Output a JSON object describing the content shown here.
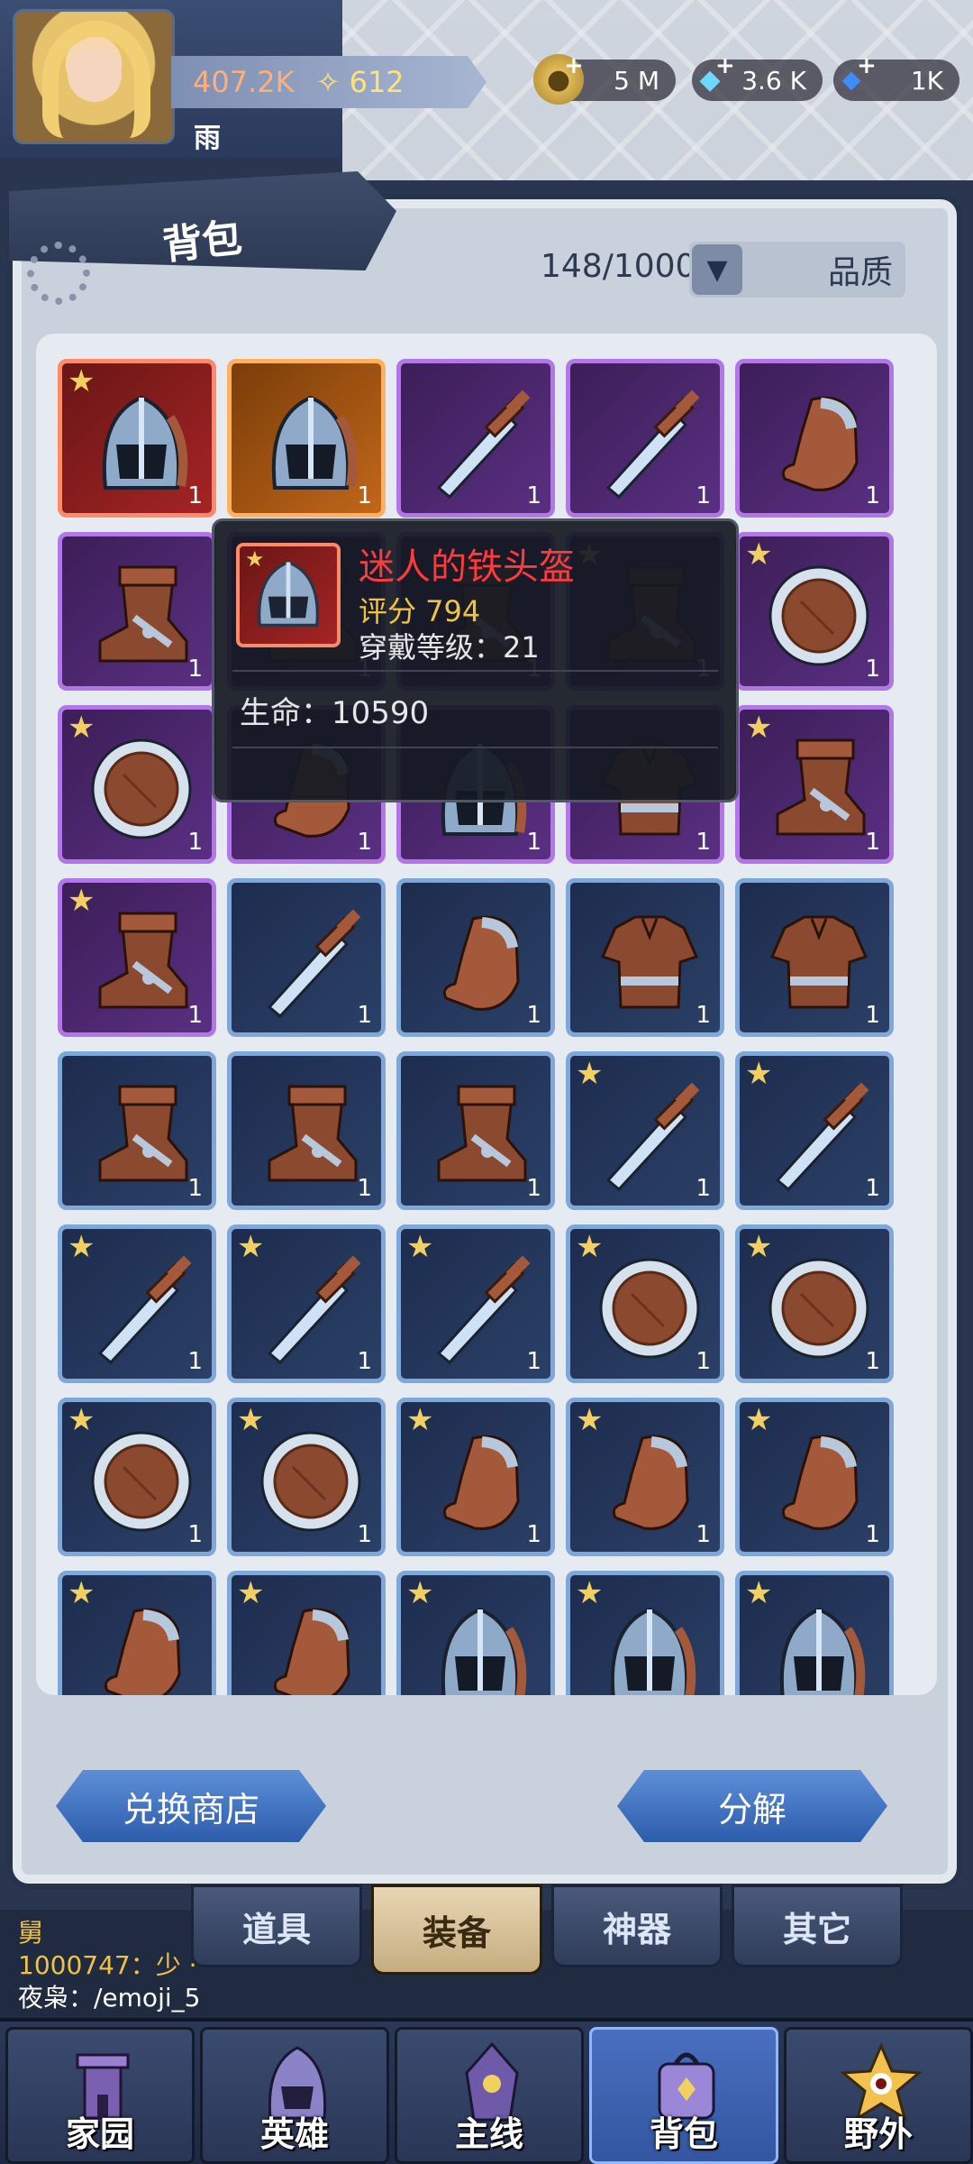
{
  "player": {
    "power": "407.2K",
    "level_label": "612",
    "name": "雨"
  },
  "currencies": {
    "gold": "5 M",
    "diamond": "3.6 K",
    "crystal": "1K"
  },
  "panel": {
    "title": "背包",
    "capacity": "148/1000",
    "filter_label": "品质"
  },
  "grid": {
    "rows": [
      [
        {
          "rarity": "red",
          "type": "helmet",
          "star": true,
          "qty": "1"
        },
        {
          "rarity": "orange",
          "type": "helmet",
          "star": false,
          "qty": "1"
        },
        {
          "rarity": "purple",
          "type": "sword",
          "star": false,
          "qty": "1"
        },
        {
          "rarity": "purple",
          "type": "sword",
          "star": false,
          "qty": "1"
        },
        {
          "rarity": "purple",
          "type": "glove",
          "star": false,
          "qty": "1"
        }
      ],
      [
        {
          "rarity": "purple",
          "type": "boot",
          "star": false,
          "qty": "1"
        },
        {
          "rarity": "purple",
          "type": "boot",
          "star": false,
          "qty": "1"
        },
        {
          "rarity": "purple",
          "type": "boot",
          "star": false,
          "qty": "1"
        },
        {
          "rarity": "purple",
          "type": "boot",
          "star": true,
          "qty": "1"
        },
        {
          "rarity": "purple",
          "type": "shield",
          "star": true,
          "qty": "1"
        }
      ],
      [
        {
          "rarity": "purple",
          "type": "shield",
          "star": true,
          "qty": "1"
        },
        {
          "rarity": "purple",
          "type": "glove",
          "star": false,
          "qty": "1"
        },
        {
          "rarity": "purple",
          "type": "helmet",
          "star": false,
          "qty": "1"
        },
        {
          "rarity": "purple",
          "type": "armor",
          "star": false,
          "qty": "1"
        },
        {
          "rarity": "purple",
          "type": "boot",
          "star": true,
          "qty": "1"
        }
      ],
      [
        {
          "rarity": "purple",
          "type": "boot",
          "star": true,
          "qty": "1"
        },
        {
          "rarity": "blue",
          "type": "sword",
          "star": false,
          "qty": "1"
        },
        {
          "rarity": "blue",
          "type": "glove",
          "star": false,
          "qty": "1"
        },
        {
          "rarity": "blue",
          "type": "armor",
          "star": false,
          "qty": "1"
        },
        {
          "rarity": "blue",
          "type": "armor",
          "star": false,
          "qty": "1"
        }
      ],
      [
        {
          "rarity": "blue",
          "type": "boot",
          "star": false,
          "qty": "1"
        },
        {
          "rarity": "blue",
          "type": "boot",
          "star": false,
          "qty": "1"
        },
        {
          "rarity": "blue",
          "type": "boot",
          "star": false,
          "qty": "1"
        },
        {
          "rarity": "blue",
          "type": "sword",
          "star": true,
          "qty": "1"
        },
        {
          "rarity": "blue",
          "type": "sword",
          "star": true,
          "qty": "1"
        }
      ],
      [
        {
          "rarity": "blue",
          "type": "sword",
          "star": true,
          "qty": "1"
        },
        {
          "rarity": "blue",
          "type": "sword",
          "star": true,
          "qty": "1"
        },
        {
          "rarity": "blue",
          "type": "sword",
          "star": true,
          "qty": "1"
        },
        {
          "rarity": "blue",
          "type": "shield",
          "star": true,
          "qty": "1"
        },
        {
          "rarity": "blue",
          "type": "shield",
          "star": true,
          "qty": "1"
        }
      ],
      [
        {
          "rarity": "blue",
          "type": "shield",
          "star": true,
          "qty": "1"
        },
        {
          "rarity": "blue",
          "type": "shield",
          "star": true,
          "qty": "1"
        },
        {
          "rarity": "blue",
          "type": "glove",
          "star": true,
          "qty": "1"
        },
        {
          "rarity": "blue",
          "type": "glove",
          "star": true,
          "qty": "1"
        },
        {
          "rarity": "blue",
          "type": "glove",
          "star": true,
          "qty": "1"
        }
      ],
      [
        {
          "rarity": "blue",
          "type": "glove",
          "star": true,
          "qty": ""
        },
        {
          "rarity": "blue",
          "type": "glove",
          "star": true,
          "qty": ""
        },
        {
          "rarity": "blue",
          "type": "helmet",
          "star": true,
          "qty": ""
        },
        {
          "rarity": "blue",
          "type": "helmet",
          "star": true,
          "qty": ""
        },
        {
          "rarity": "blue",
          "type": "helmet",
          "star": true,
          "qty": ""
        }
      ]
    ]
  },
  "tooltip": {
    "name": "迷人的铁头盔",
    "score": "评分 794",
    "wear_level": "穿戴等级：21",
    "life": "生命：10590",
    "name_color": "#ff3a3a"
  },
  "actions": {
    "exchange": "兑换商店",
    "decompose": "分解"
  },
  "chat": {
    "line1": "舅",
    "line2": "1000747：少  ·  ·  ·  ·  ·",
    "line3": "夜枭：/emoji_5"
  },
  "subtabs": {
    "items": "道具",
    "equip": "装备",
    "artifact": "神器",
    "other": "其它"
  },
  "nav": {
    "home": "家园",
    "hero": "英雄",
    "main": "主线",
    "bag": "背包",
    "wild": "野外"
  },
  "colors": {
    "accent": "#2d5cab",
    "rarity_red": "#a52424",
    "rarity_orange": "#c1671a",
    "rarity_purple": "#5a2f82",
    "rarity_blue": "#2b4067"
  }
}
